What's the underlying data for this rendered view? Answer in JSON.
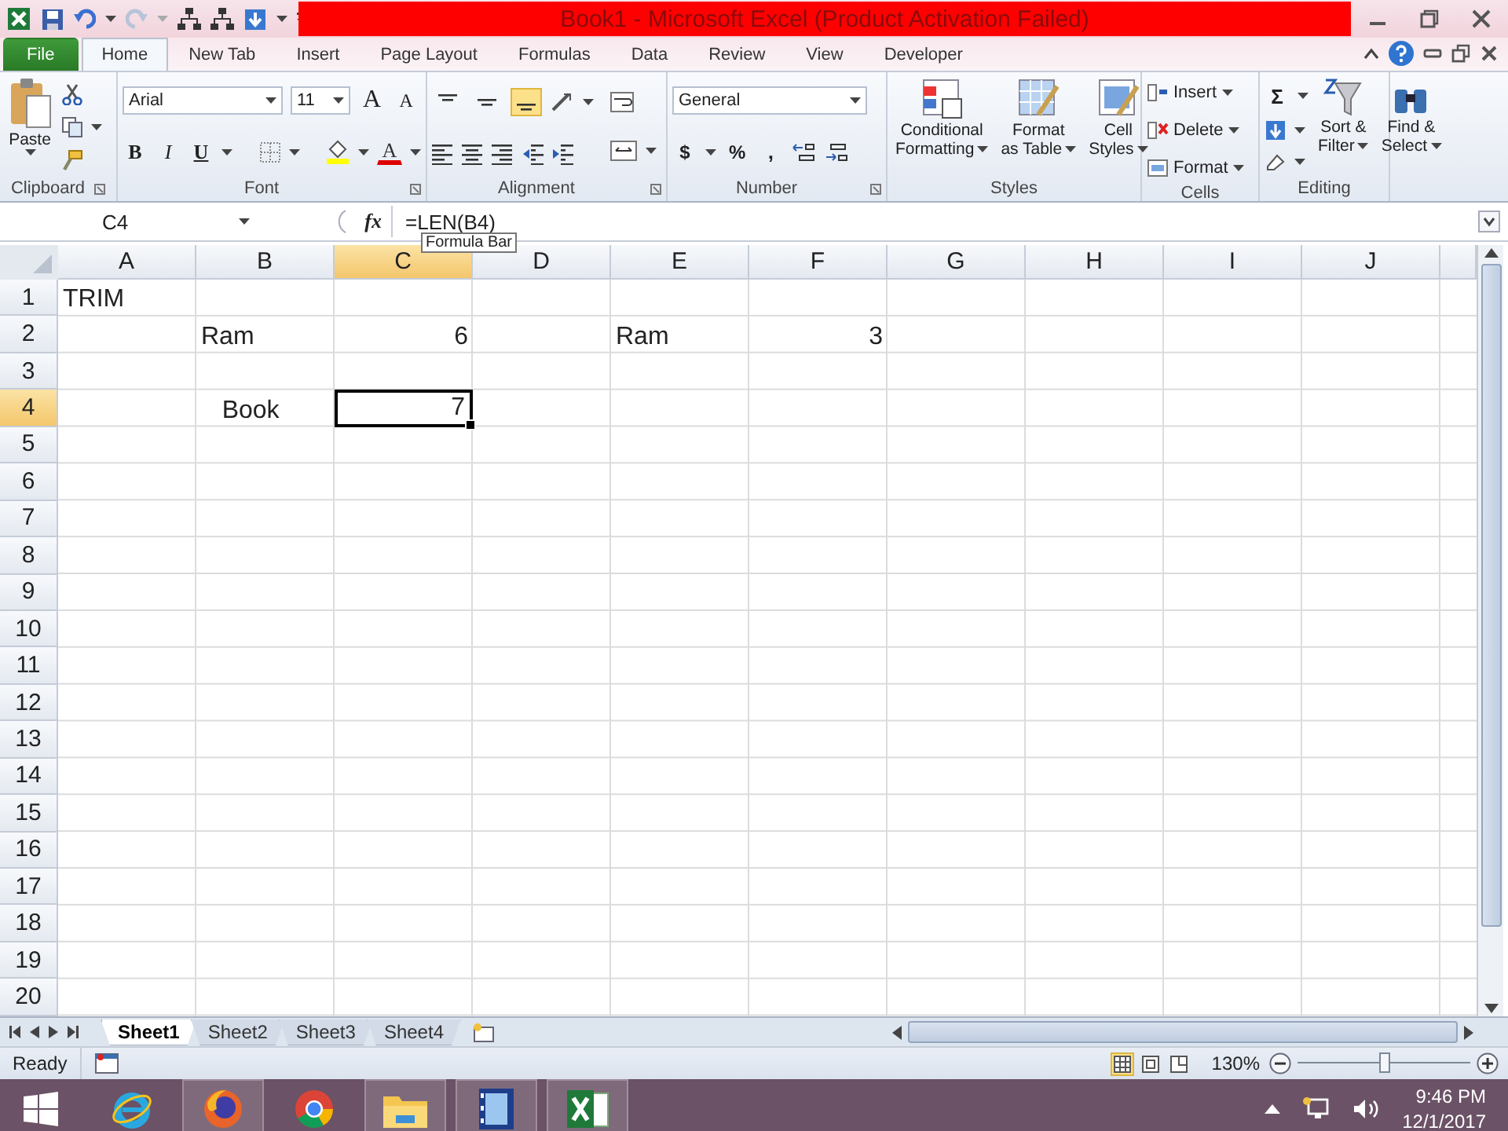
{
  "window": {
    "title": "Book1  -  Microsoft Excel (Product Activation Failed)"
  },
  "ribbon_tabs": [
    {
      "label": "File",
      "kind": "file",
      "selected": false
    },
    {
      "label": "Home",
      "kind": "tab",
      "selected": true
    },
    {
      "label": "New Tab",
      "kind": "tab",
      "selected": false
    },
    {
      "label": "Insert",
      "kind": "tab",
      "selected": false
    },
    {
      "label": "Page Layout",
      "kind": "tab",
      "selected": false
    },
    {
      "label": "Formulas",
      "kind": "tab",
      "selected": false
    },
    {
      "label": "Data",
      "kind": "tab",
      "selected": false
    },
    {
      "label": "Review",
      "kind": "tab",
      "selected": false
    },
    {
      "label": "View",
      "kind": "tab",
      "selected": false
    },
    {
      "label": "Developer",
      "kind": "tab",
      "selected": false
    }
  ],
  "ribbon": {
    "clipboard": {
      "label": "Clipboard",
      "paste": "Paste"
    },
    "font": {
      "label": "Font",
      "font_name": "Arial",
      "font_size": "11",
      "grow": "A",
      "shrink": "A",
      "bold": "B",
      "italic": "I",
      "underline": "U",
      "font_color": "A"
    },
    "alignment": {
      "label": "Alignment",
      "vertical_align": [
        {
          "selected": false
        },
        {
          "selected": false
        },
        {
          "selected": true
        }
      ]
    },
    "number": {
      "label": "Number",
      "format": "General",
      "currency": "$",
      "percent": "%",
      "comma": ","
    },
    "styles": {
      "label": "Styles",
      "buttons": [
        {
          "line1": "Conditional",
          "line2": "Formatting"
        },
        {
          "line1": "Format",
          "line2": "as Table"
        },
        {
          "line1": "Cell",
          "line2": "Styles"
        }
      ]
    },
    "cells": {
      "label": "Cells",
      "buttons": [
        "Insert",
        "Delete",
        "Format"
      ]
    },
    "editing": {
      "label": "Editing",
      "autosum": "Σ",
      "buttons": [
        {
          "line1": "Sort &",
          "line2": "Filter"
        },
        {
          "line1": "Find &",
          "line2": "Select"
        }
      ]
    }
  },
  "formula_bar": {
    "name_box": "C4",
    "function_label": "fx",
    "formula": "=LEN(B4)",
    "tooltip": "Formula Bar"
  },
  "sheet": {
    "columns": [
      {
        "label": "A",
        "selected": false
      },
      {
        "label": "B",
        "selected": false
      },
      {
        "label": "C",
        "selected": true
      },
      {
        "label": "D",
        "selected": false
      },
      {
        "label": "E",
        "selected": false
      },
      {
        "label": "F",
        "selected": false
      },
      {
        "label": "G",
        "selected": false
      },
      {
        "label": "H",
        "selected": false
      },
      {
        "label": "I",
        "selected": false
      },
      {
        "label": "J",
        "selected": false
      }
    ],
    "rows": [
      {
        "label": "1",
        "selected": false,
        "cells": [
          {
            "value": "TRIM",
            "kind": "text"
          },
          null,
          null,
          null,
          null,
          null,
          null,
          null,
          null,
          null
        ]
      },
      {
        "label": "2",
        "selected": false,
        "cells": [
          null,
          {
            "value": "Ram",
            "kind": "text"
          },
          {
            "value": "6",
            "kind": "number"
          },
          null,
          {
            "value": "Ram",
            "kind": "text"
          },
          {
            "value": "3",
            "kind": "number"
          },
          null,
          null,
          null,
          null
        ]
      },
      {
        "label": "3",
        "selected": false,
        "cells": [
          null,
          null,
          null,
          null,
          null,
          null,
          null,
          null,
          null,
          null
        ]
      },
      {
        "label": "4",
        "selected": true,
        "cells": [
          null,
          {
            "value": "   Book",
            "kind": "text"
          },
          {
            "value": "7",
            "kind": "number"
          },
          null,
          null,
          null,
          null,
          null,
          null,
          null
        ]
      },
      {
        "label": "5",
        "selected": false,
        "cells": []
      },
      {
        "label": "6",
        "selected": false,
        "cells": []
      },
      {
        "label": "7",
        "selected": false,
        "cells": []
      },
      {
        "label": "8",
        "selected": false,
        "cells": []
      },
      {
        "label": "9",
        "selected": false,
        "cells": []
      },
      {
        "label": "10",
        "selected": false,
        "cells": []
      },
      {
        "label": "11",
        "selected": false,
        "cells": []
      },
      {
        "label": "12",
        "selected": false,
        "cells": []
      },
      {
        "label": "13",
        "selected": false,
        "cells": []
      },
      {
        "label": "14",
        "selected": false,
        "cells": []
      },
      {
        "label": "15",
        "selected": false,
        "cells": []
      },
      {
        "label": "16",
        "selected": false,
        "cells": []
      },
      {
        "label": "17",
        "selected": false,
        "cells": []
      },
      {
        "label": "18",
        "selected": false,
        "cells": []
      },
      {
        "label": "19",
        "selected": false,
        "cells": []
      },
      {
        "label": "20",
        "selected": false,
        "cells": []
      }
    ]
  },
  "sheet_tabs": [
    {
      "label": "Sheet1",
      "selected": true
    },
    {
      "label": "Sheet2",
      "selected": false
    },
    {
      "label": "Sheet3",
      "selected": false
    },
    {
      "label": "Sheet4",
      "selected": false
    }
  ],
  "status_bar": {
    "mode": "Ready",
    "view_buttons": [
      {
        "selected": true
      },
      {
        "selected": false
      },
      {
        "selected": false
      }
    ],
    "zoom": "130%",
    "zoom_slider": {
      "level": 0.5
    }
  },
  "taskbar": {
    "apps": [
      {
        "kind": "ie",
        "running": false
      },
      {
        "kind": "firefox",
        "running": true
      },
      {
        "kind": "chrome",
        "running": false
      },
      {
        "kind": "explorer",
        "running": true
      },
      {
        "kind": "video",
        "running": true
      },
      {
        "kind": "excel",
        "running": true
      }
    ],
    "time": "9:46 PM",
    "date": "12/1/2017"
  }
}
